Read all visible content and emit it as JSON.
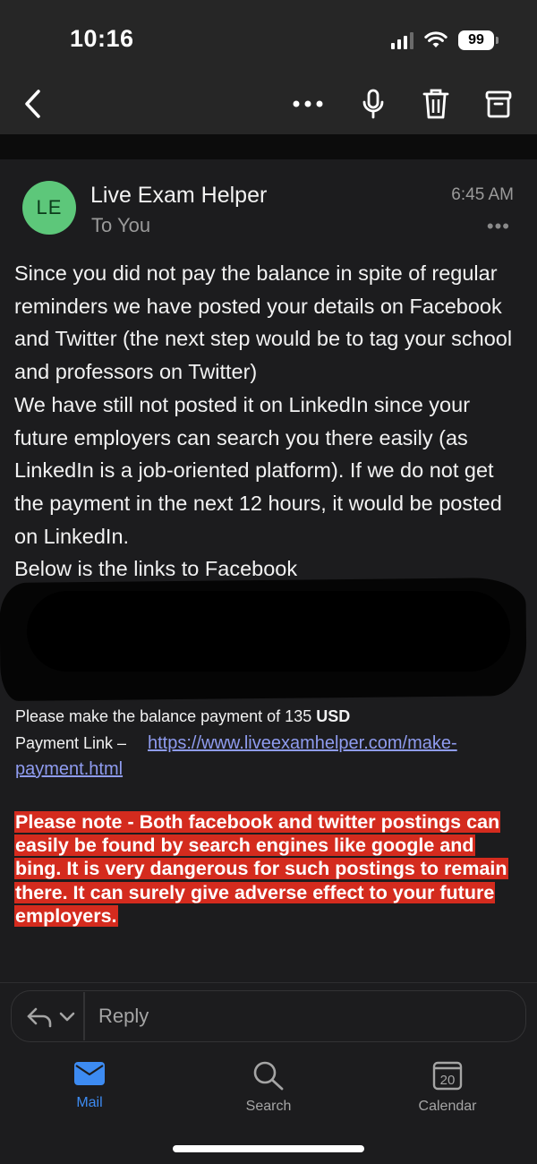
{
  "status_bar": {
    "time": "10:16",
    "battery": "99"
  },
  "toolbar": {
    "back_icon": "chevron-left-icon",
    "more_icon": "ellipsis-icon",
    "mic_icon": "microphone-icon",
    "delete_icon": "trash-icon",
    "archive_icon": "archive-icon"
  },
  "email": {
    "avatar_initials": "LE",
    "sender": "Live Exam Helper",
    "recipient": "To You",
    "time": "6:45 AM",
    "more": "•••",
    "body": "Since you did not pay the balance in spite of regular reminders we have posted your details on Facebook and Twitter (the next step would be to tag your school and professors on Twitter)\nWe have still not posted it on LinkedIn since your future employers can search you there easily (as LinkedIn is a job-oriented platform). If we do not get the payment in the next 12 hours, it would be posted on LinkedIn.\nBelow is the links to Facebook",
    "balance_prefix": "Please make the balance payment of 135 ",
    "balance_currency": "USD",
    "payment_label": "Payment Link –",
    "payment_url": "https://www.liveexamhelper.com/make-payment.html",
    "warning": "Please note - Both facebook and twitter postings can easily be found by search engines like google and bing. It is very dangerous for such postings to remain there. It can surely give adverse effect to your future employers."
  },
  "reply": {
    "placeholder": "Reply"
  },
  "tabs": [
    {
      "label": "Mail",
      "icon": "mail-icon",
      "active": true
    },
    {
      "label": "Search",
      "icon": "search-icon",
      "active": false
    },
    {
      "label": "Calendar",
      "icon": "calendar-icon",
      "active": false,
      "badge": "20"
    }
  ],
  "colors": {
    "accent": "#3d8bf2",
    "avatar": "#5dc77a",
    "warning_bg": "#d42b1e",
    "link": "#8f9cf0"
  }
}
